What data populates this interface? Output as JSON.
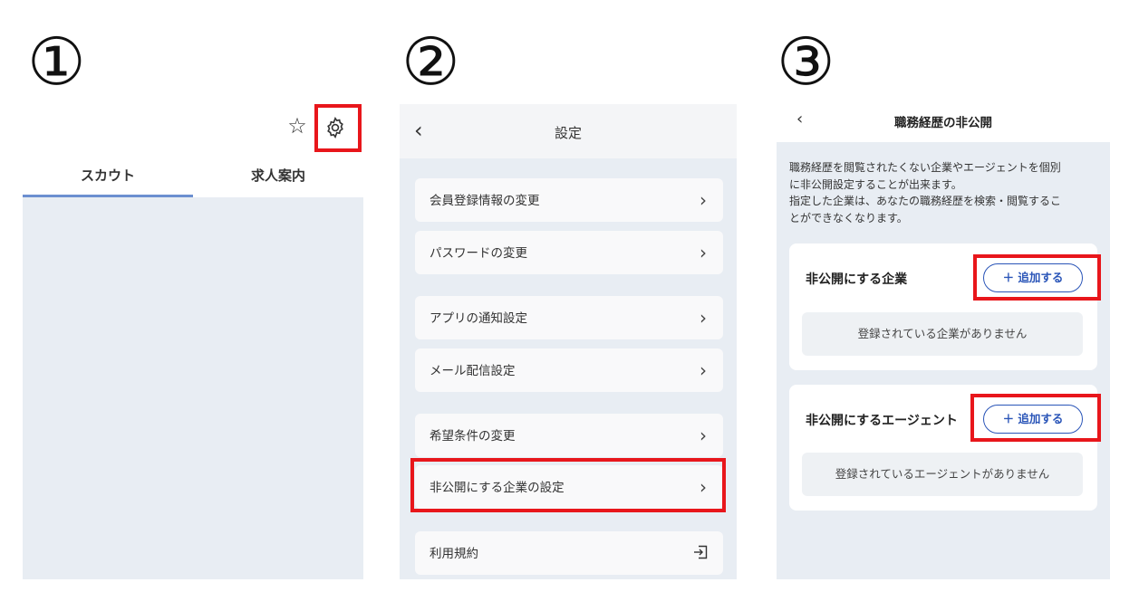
{
  "steps": [
    "①",
    "②",
    "③"
  ],
  "panel1": {
    "icons": {
      "favorite": "star-icon",
      "settings": "gear-icon"
    },
    "tabs": [
      {
        "label": "スカウト",
        "active": true
      },
      {
        "label": "求人案内",
        "active": false
      }
    ]
  },
  "panel2": {
    "header": {
      "back": "‹",
      "title": "設定"
    },
    "items": [
      {
        "label": "会員登録情報の変更",
        "icon": "chevron-right-icon"
      },
      {
        "label": "パスワードの変更",
        "icon": "chevron-right-icon"
      },
      {
        "label": "アプリの通知設定",
        "icon": "chevron-right-icon"
      },
      {
        "label": "メール配信設定",
        "icon": "chevron-right-icon"
      },
      {
        "label": "希望条件の変更",
        "icon": "chevron-right-icon"
      },
      {
        "label": "非公開にする企業の設定",
        "icon": "chevron-right-icon"
      },
      {
        "label": "利用規約",
        "icon": "external-link-icon"
      }
    ],
    "chevron": "›"
  },
  "panel3": {
    "header": {
      "back": "‹",
      "title": "職務経歴の非公開"
    },
    "description": [
      "職務経歴を閲覧されたくない企業やエージェントを個別",
      "に非公開設定することが出来ます。",
      "指定した企業は、あなたの職務経歴を検索・閲覧するこ",
      "とができなくなります。"
    ],
    "companies": {
      "title": "非公開にする企業",
      "add_label": "＋ 追加する",
      "empty": "登録されている企業がありません"
    },
    "agents": {
      "title": "非公開にするエージェント",
      "add_label": "＋ 追加する",
      "empty": "登録されているエージェントがありません"
    }
  },
  "colors": {
    "highlight": "#e8161b",
    "accent": "#2a55b8",
    "tab_underline": "#6c8fd0",
    "background": "#e8edf3"
  }
}
